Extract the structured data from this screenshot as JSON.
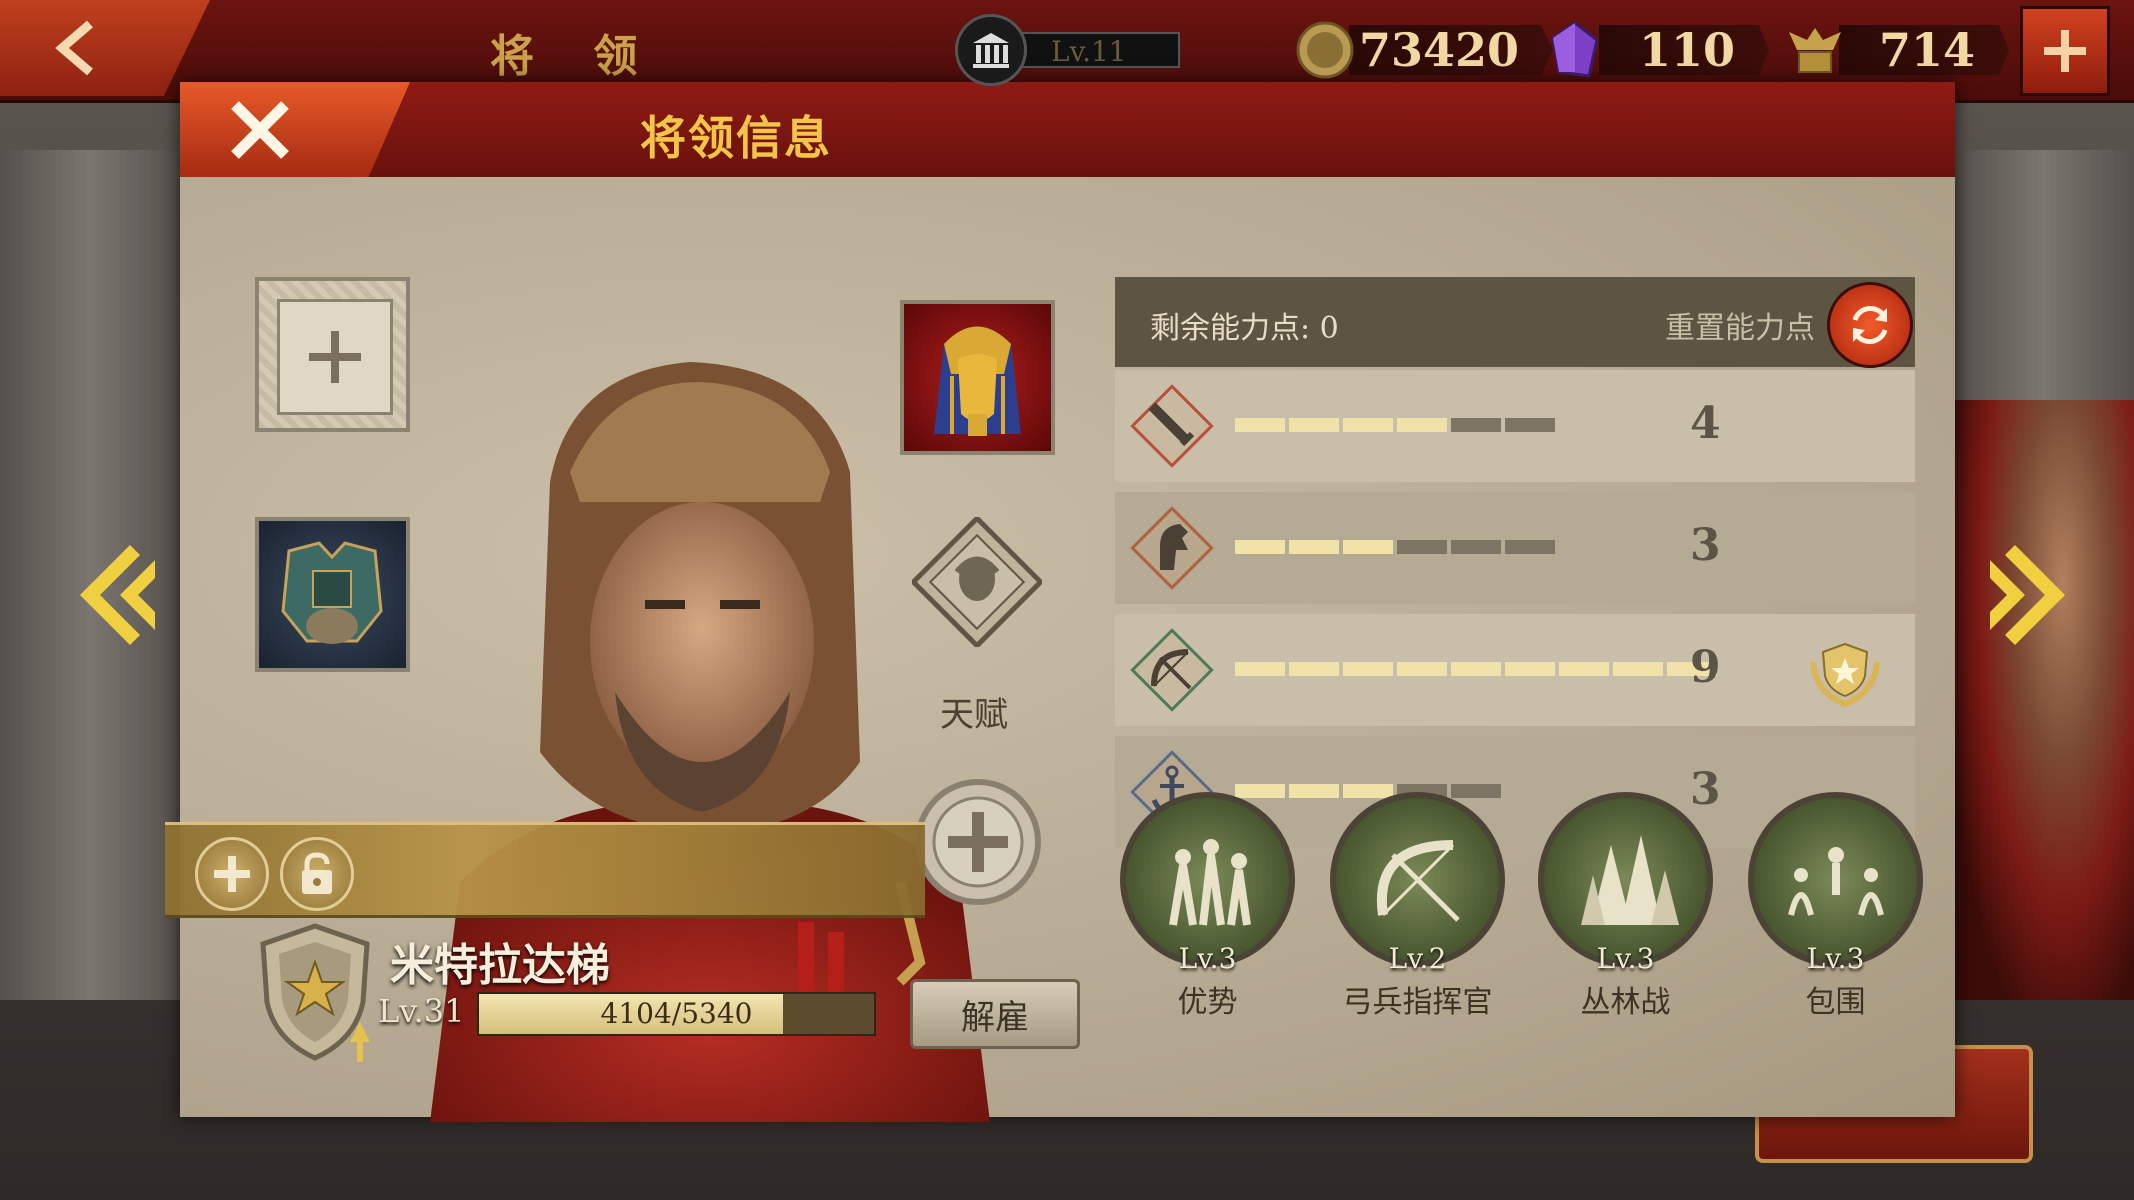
{
  "top_bar": {
    "title": "将 领",
    "building_level": "Lv.11",
    "coins": "73420",
    "gems": "110",
    "tokens": "714"
  },
  "dialog": {
    "title": "将领信息",
    "talent_label": "天赋",
    "hero": {
      "name": "米特拉达梯",
      "level": "Lv.31",
      "xp_text": "4104/5340",
      "xp_fraction": 0.7685,
      "dismiss_label": "解雇"
    },
    "stats": {
      "remaining_label": "剩余能力点: 0",
      "reset_label": "重置能力点",
      "rows": [
        {
          "icon": "sword-icon",
          "value": "4",
          "filled": 4,
          "total": 6
        },
        {
          "icon": "horse-icon",
          "value": "3",
          "filled": 3,
          "total": 6
        },
        {
          "icon": "bow-icon",
          "value": "9",
          "filled": 9,
          "total": 9
        },
        {
          "icon": "anchor-icon",
          "value": "3",
          "filled": 3,
          "total": 5
        }
      ]
    },
    "skills": [
      {
        "level": "Lv.3",
        "name": "优势"
      },
      {
        "level": "Lv.2",
        "name": "弓兵指挥官"
      },
      {
        "level": "Lv.3",
        "name": "丛林战"
      },
      {
        "level": "Lv.3",
        "name": "包围"
      }
    ]
  },
  "colors": {
    "header_red": "#8e1b14",
    "accent_orange": "#e65a28",
    "gold_text": "#f1c548",
    "bar_on": "#f0e2a8",
    "bar_off": "#7d7463"
  }
}
